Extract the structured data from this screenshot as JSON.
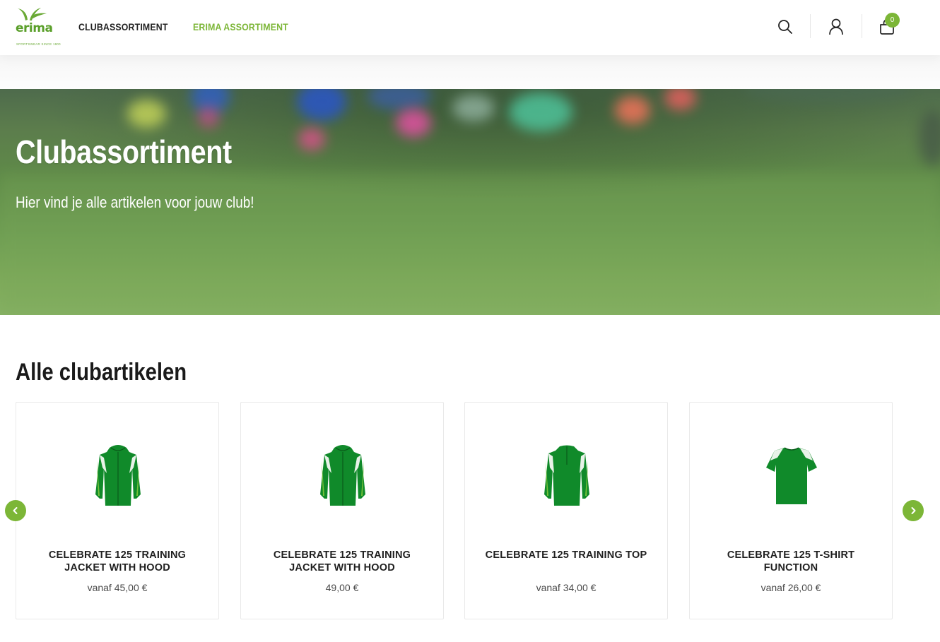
{
  "brand": {
    "name": "erima",
    "tagline": "SPORTSWEAR SINCE 1900",
    "accent_color": "#7cb637"
  },
  "nav": {
    "items": [
      {
        "label": "CLUBASSORTIMENT"
      },
      {
        "label": "ERIMA ASSORTIMENT"
      }
    ]
  },
  "header_actions": {
    "search_icon": "search-icon",
    "account_icon": "user-icon",
    "cart_icon": "bag-icon",
    "cart_count": "0"
  },
  "hero": {
    "title": "Clubassortiment",
    "subtitle": "Hier vind je alle artikelen voor jouw club!"
  },
  "section": {
    "title": "Alle clubartikelen"
  },
  "products": [
    {
      "name": "CELEBRATE 125 TRAINING JACKET WITH HOOD",
      "price": "vanaf 45,00 €",
      "image": "green-hooded-jacket"
    },
    {
      "name": "CELEBRATE 125 TRAINING JACKET WITH HOOD",
      "price": "49,00 €",
      "image": "green-hooded-jacket"
    },
    {
      "name": "CELEBRATE 125 TRAINING TOP",
      "price": "vanaf 34,00 €",
      "image": "green-training-top"
    },
    {
      "name": "CELEBRATE 125 T-SHIRT FUNCTION",
      "price": "vanaf 26,00 €",
      "image": "green-t-shirt"
    }
  ],
  "carousel": {
    "prev_icon": "chevron-left-icon",
    "next_icon": "chevron-right-icon"
  }
}
